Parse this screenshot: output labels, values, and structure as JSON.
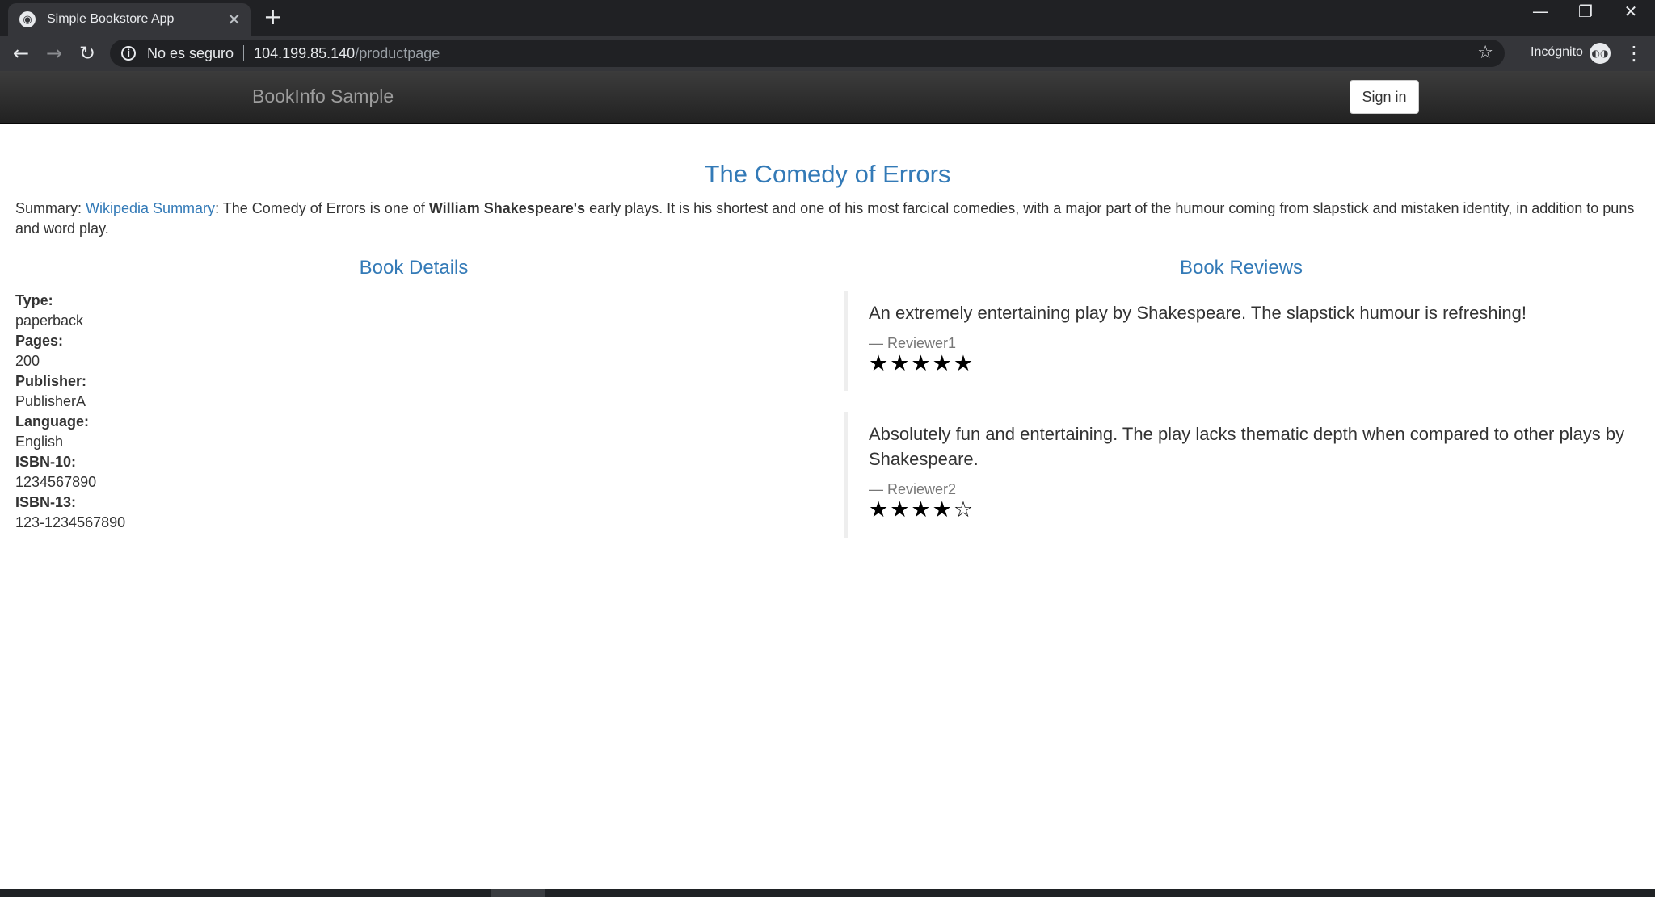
{
  "browser": {
    "tab_title": "Simple Bookstore App",
    "tab_close": "✕",
    "new_tab": "+",
    "security_text": "No es seguro",
    "url_host": "104.199.85.140",
    "url_path": "/productpage",
    "incognito_label": "Incógnito"
  },
  "navbar": {
    "brand": "BookInfo Sample",
    "signin_label": "Sign in"
  },
  "book": {
    "title": "The Comedy of Errors",
    "summary_prefix": "Summary: ",
    "summary_link": "Wikipedia Summary",
    "summary_text_1": ": The Comedy of Errors is one of ",
    "summary_bold": "William Shakespeare's",
    "summary_text_2": " early plays. It is his shortest and one of his most farcical comedies, with a major part of the humour coming from slapstick and mistaken identity, in addition to puns and word play."
  },
  "details": {
    "heading": "Book Details",
    "fields": [
      {
        "label": "Type:",
        "value": "paperback"
      },
      {
        "label": "Pages:",
        "value": "200"
      },
      {
        "label": "Publisher:",
        "value": "PublisherA"
      },
      {
        "label": "Language:",
        "value": "English"
      },
      {
        "label": "ISBN-10:",
        "value": "1234567890"
      },
      {
        "label": "ISBN-13:",
        "value": "123-1234567890"
      }
    ]
  },
  "reviews": {
    "heading": "Book Reviews",
    "items": [
      {
        "text": "An extremely entertaining play by Shakespeare. The slapstick humour is refreshing!",
        "author": "— Reviewer1",
        "rating": 5,
        "stars": "★★★★★"
      },
      {
        "text": "Absolutely fun and entertaining. The play lacks thematic depth when compared to other plays by Shakespeare.",
        "author": "— Reviewer2",
        "rating": 4,
        "stars": "★★★★☆"
      }
    ]
  },
  "colors": {
    "link": "#337ab7",
    "navbar": "#222222",
    "browser_frame": "#202124"
  }
}
